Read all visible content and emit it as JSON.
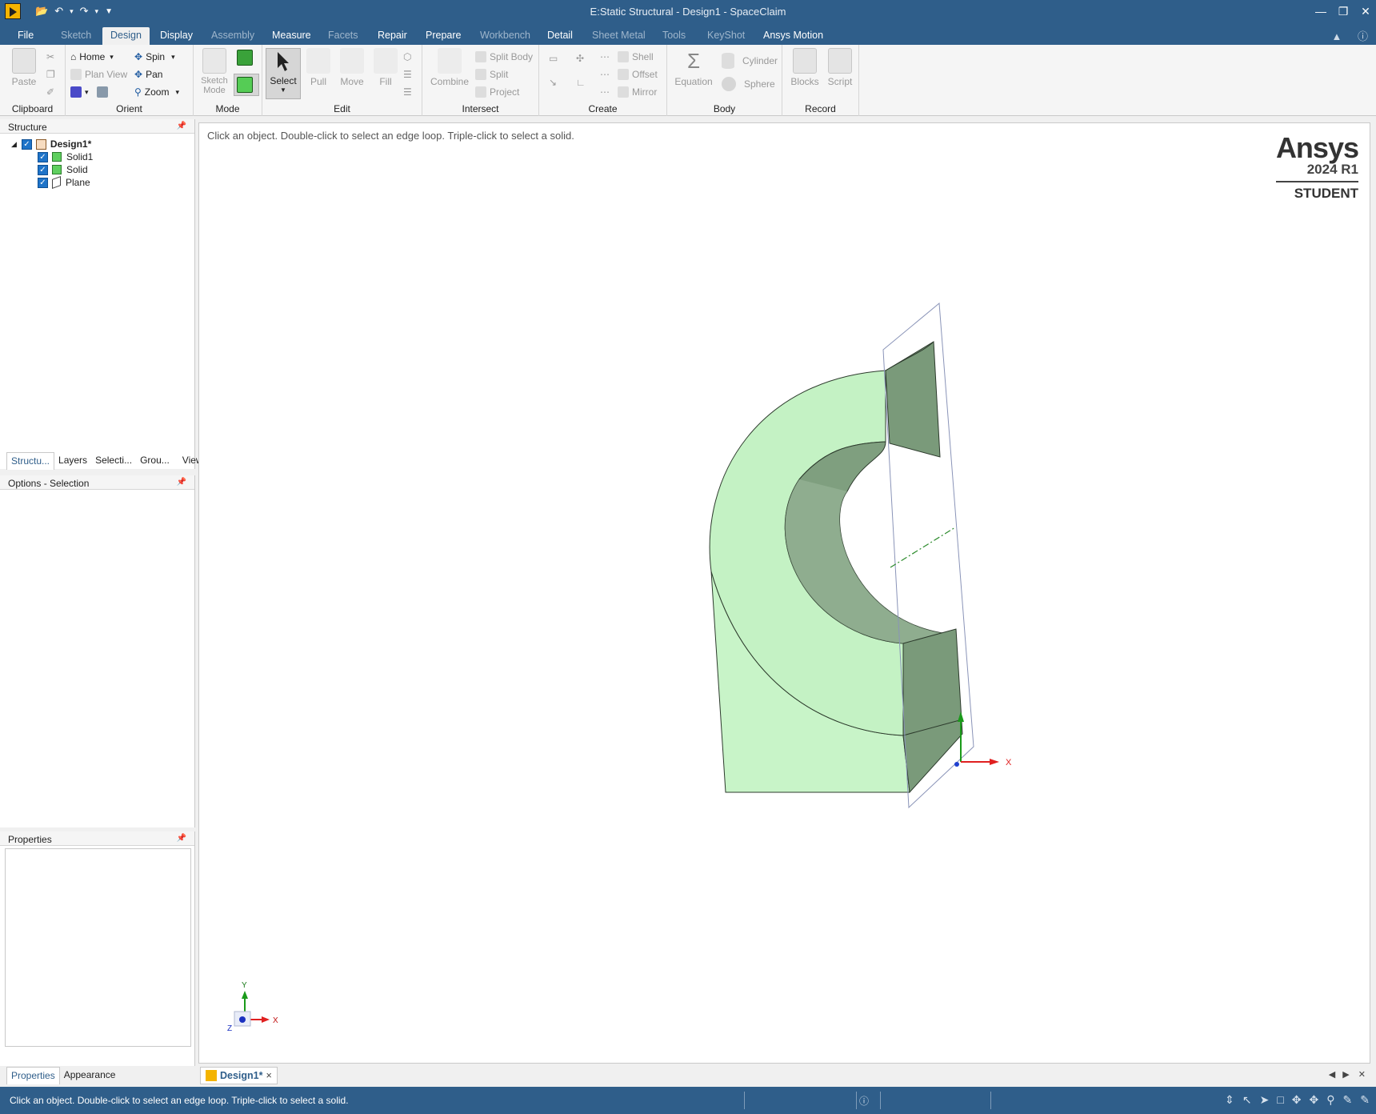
{
  "window": {
    "title": "E:Static Structural - Design1 - SpaceClaim"
  },
  "menu": {
    "tabs": [
      {
        "label": "File"
      },
      {
        "label": "Sketch"
      },
      {
        "label": "Design"
      },
      {
        "label": "Display"
      },
      {
        "label": "Assembly"
      },
      {
        "label": "Measure"
      },
      {
        "label": "Facets"
      },
      {
        "label": "Repair"
      },
      {
        "label": "Prepare"
      },
      {
        "label": "Workbench"
      },
      {
        "label": "Detail"
      },
      {
        "label": "Sheet Metal"
      },
      {
        "label": "Tools"
      },
      {
        "label": "KeyShot"
      },
      {
        "label": "Ansys Motion"
      }
    ],
    "active": "Design"
  },
  "ribbon": {
    "clipboard": {
      "label": "Clipboard",
      "paste": "Paste"
    },
    "orient": {
      "label": "Orient",
      "home": "Home",
      "plan_view": "Plan View",
      "spin": "Spin",
      "pan": "Pan",
      "zoom": "Zoom"
    },
    "mode": {
      "label": "Mode",
      "sketch_mode": "Sketch Mode"
    },
    "edit": {
      "label": "Edit",
      "select": "Select",
      "pull": "Pull",
      "move": "Move",
      "fill": "Fill"
    },
    "intersect": {
      "label": "Intersect",
      "combine": "Combine",
      "split_body": "Split Body",
      "split": "Split",
      "project": "Project"
    },
    "create": {
      "label": "Create",
      "shell": "Shell",
      "offset": "Offset",
      "mirror": "Mirror"
    },
    "body": {
      "label": "Body",
      "equation": "Equation",
      "cylinder": "Cylinder",
      "sphere": "Sphere"
    },
    "record": {
      "label": "Record",
      "blocks": "Blocks",
      "script": "Script"
    }
  },
  "structure": {
    "title": "Structure",
    "root": "Design1*",
    "items": [
      {
        "label": "Solid1"
      },
      {
        "label": "Solid"
      },
      {
        "label": "Plane"
      }
    ],
    "tabs": [
      "Structu...",
      "Layers",
      "Selecti...",
      "Grou...",
      "Views"
    ]
  },
  "options": {
    "title": "Options - Selection"
  },
  "properties": {
    "title": "Properties",
    "tabs": [
      "Properties",
      "Appearance"
    ]
  },
  "viewport": {
    "hint": "Click an object. Double-click to select an edge loop. Triple-click to select a solid.",
    "brand": {
      "name": "Ansys",
      "version": "2024 R1",
      "edition": "STUDENT"
    },
    "axis_labels": {
      "x": "X",
      "y": "Y",
      "z": "Z"
    }
  },
  "doc_tab": {
    "label": "Design1*"
  },
  "status": {
    "text": "Click an object. Double-click to select an edge loop. Triple-click to select a solid."
  },
  "colors": {
    "chrome": "#2f5e8a",
    "solid": "#c2f2c2",
    "solid_dark": "#7a9a7a",
    "plane": "#8a94b8"
  }
}
